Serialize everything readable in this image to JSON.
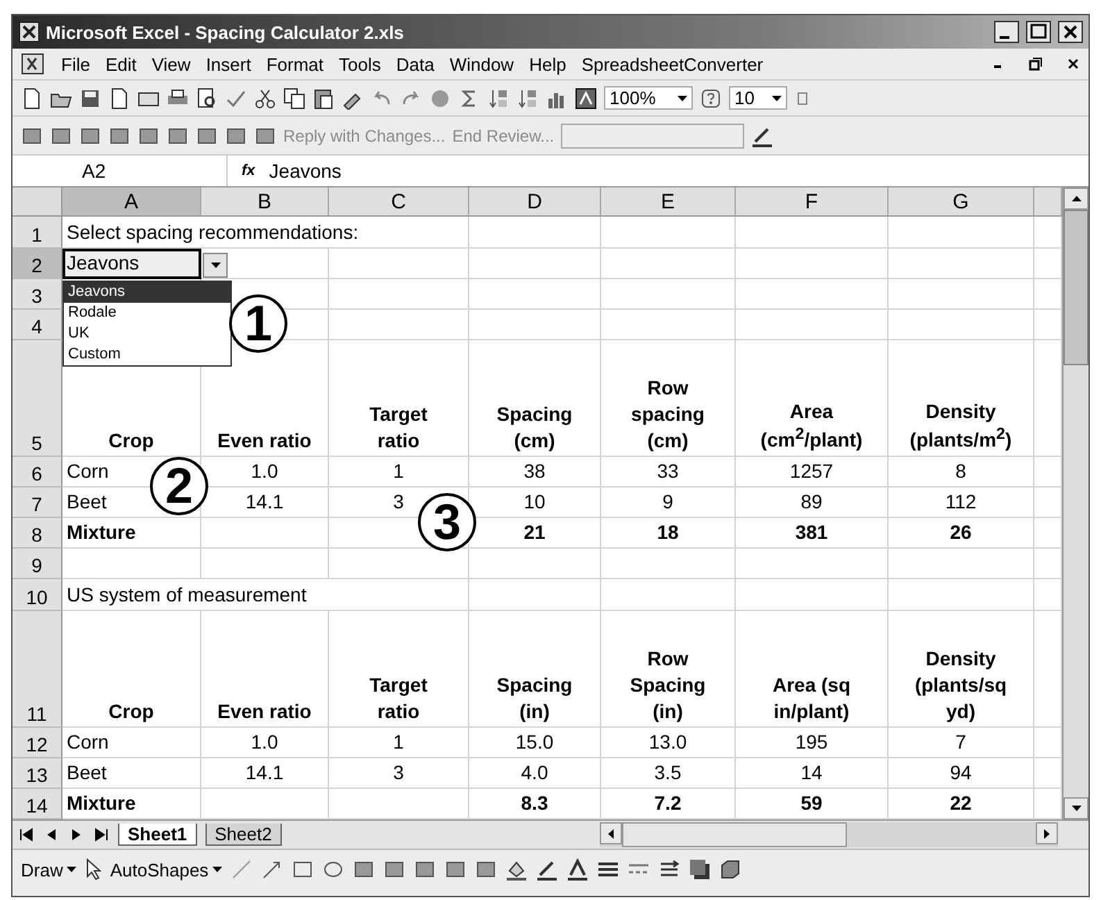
{
  "window": {
    "title": "Microsoft Excel - Spacing Calculator 2.xls"
  },
  "menu": [
    "File",
    "Edit",
    "View",
    "Insert",
    "Format",
    "Tools",
    "Data",
    "Window",
    "Help",
    "SpreadsheetConverter"
  ],
  "toolbar": {
    "zoom": "100%",
    "font_size": "10"
  },
  "review_toolbar": {
    "reply": "Reply with Changes...",
    "end_review": "End Review..."
  },
  "formula_bar": {
    "name_box": "A2",
    "function_label": "fx",
    "formula": "Jeavons"
  },
  "columns": [
    {
      "label": "A",
      "selected": true
    },
    {
      "label": "B",
      "selected": false
    },
    {
      "label": "C",
      "selected": false
    },
    {
      "label": "D",
      "selected": false
    },
    {
      "label": "E",
      "selected": false
    },
    {
      "label": "F",
      "selected": false
    },
    {
      "label": "G",
      "selected": false
    }
  ],
  "rows": [
    {
      "num": "1",
      "kind": "title",
      "selected": false,
      "cells": [
        "Select spacing recommendations:",
        null,
        null,
        null,
        null,
        null,
        null
      ]
    },
    {
      "num": "2",
      "kind": "data",
      "selected": true,
      "cells": [
        "Jeavons",
        null,
        null,
        null,
        null,
        null,
        null
      ]
    },
    {
      "num": "3",
      "kind": "data",
      "selected": false,
      "cells": [
        null,
        null,
        null,
        null,
        null,
        null,
        null
      ]
    },
    {
      "num": "4",
      "kind": "data",
      "selected": false,
      "cells": [
        null,
        null,
        null,
        null,
        null,
        null,
        null
      ]
    },
    {
      "num": "5",
      "kind": "header",
      "selected": false,
      "cells": [
        "Crop",
        "Even ratio",
        "Target\nratio",
        "Spacing\n(cm)",
        "Row\nspacing\n(cm)",
        "Area\n(cm$^{2}$/plant)",
        "Density\n(plants/m$^{2}$)"
      ]
    },
    {
      "num": "6",
      "kind": "data",
      "selected": false,
      "cells": [
        "Corn",
        "1.0",
        "1",
        "38",
        "33",
        "1257",
        "8"
      ]
    },
    {
      "num": "7",
      "kind": "data",
      "selected": false,
      "cells": [
        "Beet",
        "14.1",
        "3",
        "10",
        "9",
        "89",
        "112"
      ]
    },
    {
      "num": "8",
      "kind": "total",
      "selected": false,
      "cells": [
        "Mixture",
        null,
        null,
        "21",
        "18",
        "381",
        "26"
      ]
    },
    {
      "num": "9",
      "kind": "data",
      "selected": false,
      "cells": [
        null,
        null,
        null,
        null,
        null,
        null,
        null
      ]
    },
    {
      "num": "10",
      "kind": "title",
      "selected": false,
      "cells": [
        "US system of measurement",
        null,
        null,
        null,
        null,
        null,
        null
      ]
    },
    {
      "num": "11",
      "kind": "header",
      "selected": false,
      "cells": [
        "Crop",
        "Even ratio",
        "Target\nratio",
        "Spacing\n(in)",
        "Row\nSpacing\n(in)",
        "Area (sq\nin/plant)",
        "Density\n(plants/sq\nyd)"
      ]
    },
    {
      "num": "12",
      "kind": "data",
      "selected": false,
      "cells": [
        "Corn",
        "1.0",
        "1",
        "15.0",
        "13.0",
        "195",
        "7"
      ]
    },
    {
      "num": "13",
      "kind": "data",
      "selected": false,
      "cells": [
        "Beet",
        "14.1",
        "3",
        "4.0",
        "3.5",
        "14",
        "94"
      ]
    },
    {
      "num": "14",
      "kind": "total",
      "selected": false,
      "cells": [
        "Mixture",
        null,
        null,
        "8.3",
        "7.2",
        "59",
        "22"
      ]
    }
  ],
  "dropdown": {
    "options": [
      {
        "label": "Jeavons",
        "selected": true
      },
      {
        "label": "Rodale",
        "selected": false
      },
      {
        "label": "UK",
        "selected": false
      },
      {
        "label": "Custom",
        "selected": false
      }
    ]
  },
  "callouts": [
    "1",
    "2",
    "3"
  ],
  "sheet_tabs": [
    {
      "label": "Sheet1",
      "selected": true
    },
    {
      "label": "Sheet2",
      "selected": false
    }
  ],
  "drawing_toolbar": {
    "draw": "Draw",
    "autoshapes": "AutoShapes"
  }
}
